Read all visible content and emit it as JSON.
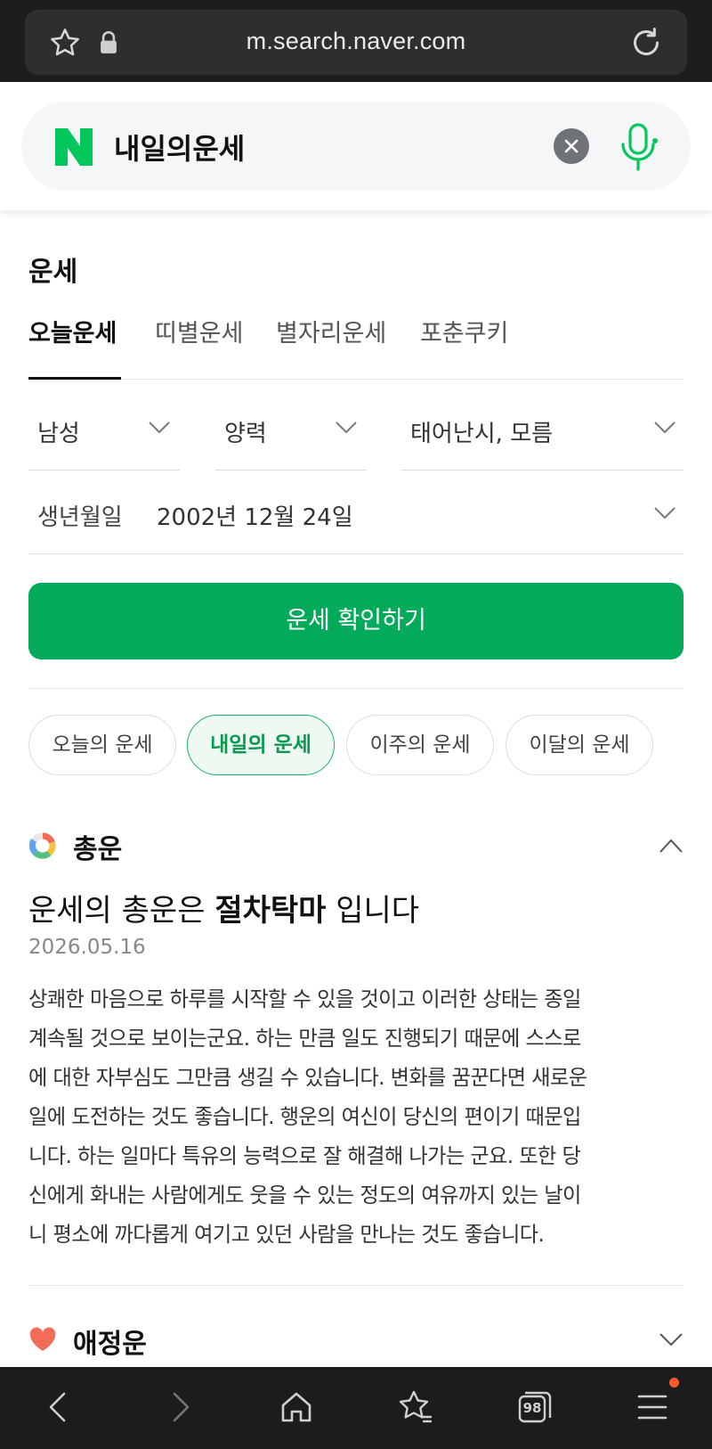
{
  "browser": {
    "url": "m.search.naver.com",
    "tab_count": "98"
  },
  "search": {
    "logo": "N",
    "query": "내일의운세"
  },
  "section": {
    "title": "운세"
  },
  "tabs": [
    {
      "label": "오늘운세",
      "active": true
    },
    {
      "label": "띠별운세",
      "active": false
    },
    {
      "label": "별자리운세",
      "active": false
    },
    {
      "label": "포춘쿠키",
      "active": false
    }
  ],
  "form": {
    "gender": "남성",
    "calendar": "양력",
    "birth_time": "태어난시, 모름",
    "birth_label": "생년월일",
    "birth_value": "2002년 12월 24일",
    "confirm_label": "운세 확인하기"
  },
  "periods": [
    {
      "label": "오늘의 운세",
      "active": false
    },
    {
      "label": "내일의 운세",
      "active": true
    },
    {
      "label": "이주의 운세",
      "active": false
    },
    {
      "label": "이달의 운세",
      "active": false
    }
  ],
  "summary": {
    "heading": "총운",
    "result_prefix": "운세의 총운은",
    "result_keyword": "절차탁마",
    "result_suffix": "입니다",
    "date": "2026.05.16",
    "lines": [
      "상쾌한 마음으로 하루를 시작할 수 있을 것이고 이러한 상태는 종일",
      "계속될 것으로 보이는군요. 하는 만큼 일도 진행되기 때문에 스스로",
      "에 대한 자부심도 그만큼 생길 수 있습니다. 변화를 꿈꾼다면 새로운",
      "일에 도전하는 것도 좋습니다. 행운의 여신이 당신의 편이기 때문입",
      "니다. 하는 일마다 특유의 능력으로 잘 해결해 나가는 군요. 또한 당",
      "신에게 화내는 사람에게도 웃을 수 있는 정도의 여유까지 있는 날이",
      "니 평소에 까다롭게 여기고 있던 사람을 만나는 것도 좋습니다."
    ]
  },
  "love": {
    "heading": "애정운"
  },
  "colors": {
    "brand_green": "#03aa5a",
    "dark_bar": "#1c1c1e"
  }
}
